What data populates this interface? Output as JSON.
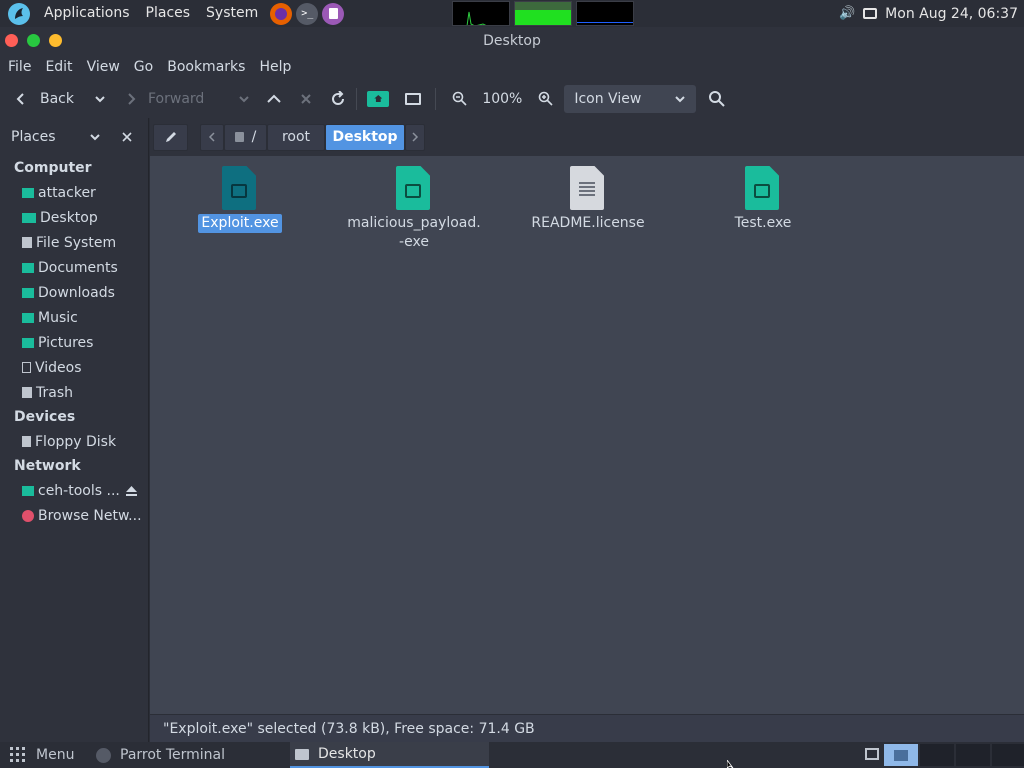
{
  "top_panel": {
    "menus": [
      "Applications",
      "Places",
      "System"
    ],
    "clock": "Mon Aug 24, 06:37"
  },
  "window": {
    "title": "Desktop"
  },
  "menubar": [
    "File",
    "Edit",
    "View",
    "Go",
    "Bookmarks",
    "Help"
  ],
  "toolbar": {
    "back": "Back",
    "forward": "Forward",
    "zoom": "100%",
    "view_mode": "Icon View"
  },
  "sidebar": {
    "header": "Places",
    "sections": [
      {
        "title": "Computer",
        "items": [
          "attacker",
          "Desktop",
          "File System",
          "Documents",
          "Downloads",
          "Music",
          "Pictures",
          "Videos",
          "Trash"
        ]
      },
      {
        "title": "Devices",
        "items": [
          "Floppy Disk"
        ]
      },
      {
        "title": "Network",
        "items": [
          "ceh-tools ...",
          "Browse Netw..."
        ]
      }
    ]
  },
  "pathbar": {
    "root": "/",
    "segments": [
      "root",
      "Desktop"
    ]
  },
  "files": [
    {
      "name": "Exploit.exe",
      "selected": true,
      "type": "executable"
    },
    {
      "name": "malicious_payload.-exe",
      "selected": false,
      "type": "executable"
    },
    {
      "name": "README.license",
      "selected": false,
      "type": "text"
    },
    {
      "name": "Test.exe",
      "selected": false,
      "type": "executable"
    }
  ],
  "status": "\"Exploit.exe\" selected (73.8 kB), Free space: 71.4 GB",
  "bottom_panel": {
    "menu": "Menu",
    "tasks": [
      "Parrot Terminal",
      "Desktop"
    ]
  },
  "colors": {
    "accent": "#5294e2",
    "exe_icon": "#1abc9c",
    "close": "#ff5f57",
    "maximize": "#28c840",
    "minimize": "#febc2e"
  }
}
